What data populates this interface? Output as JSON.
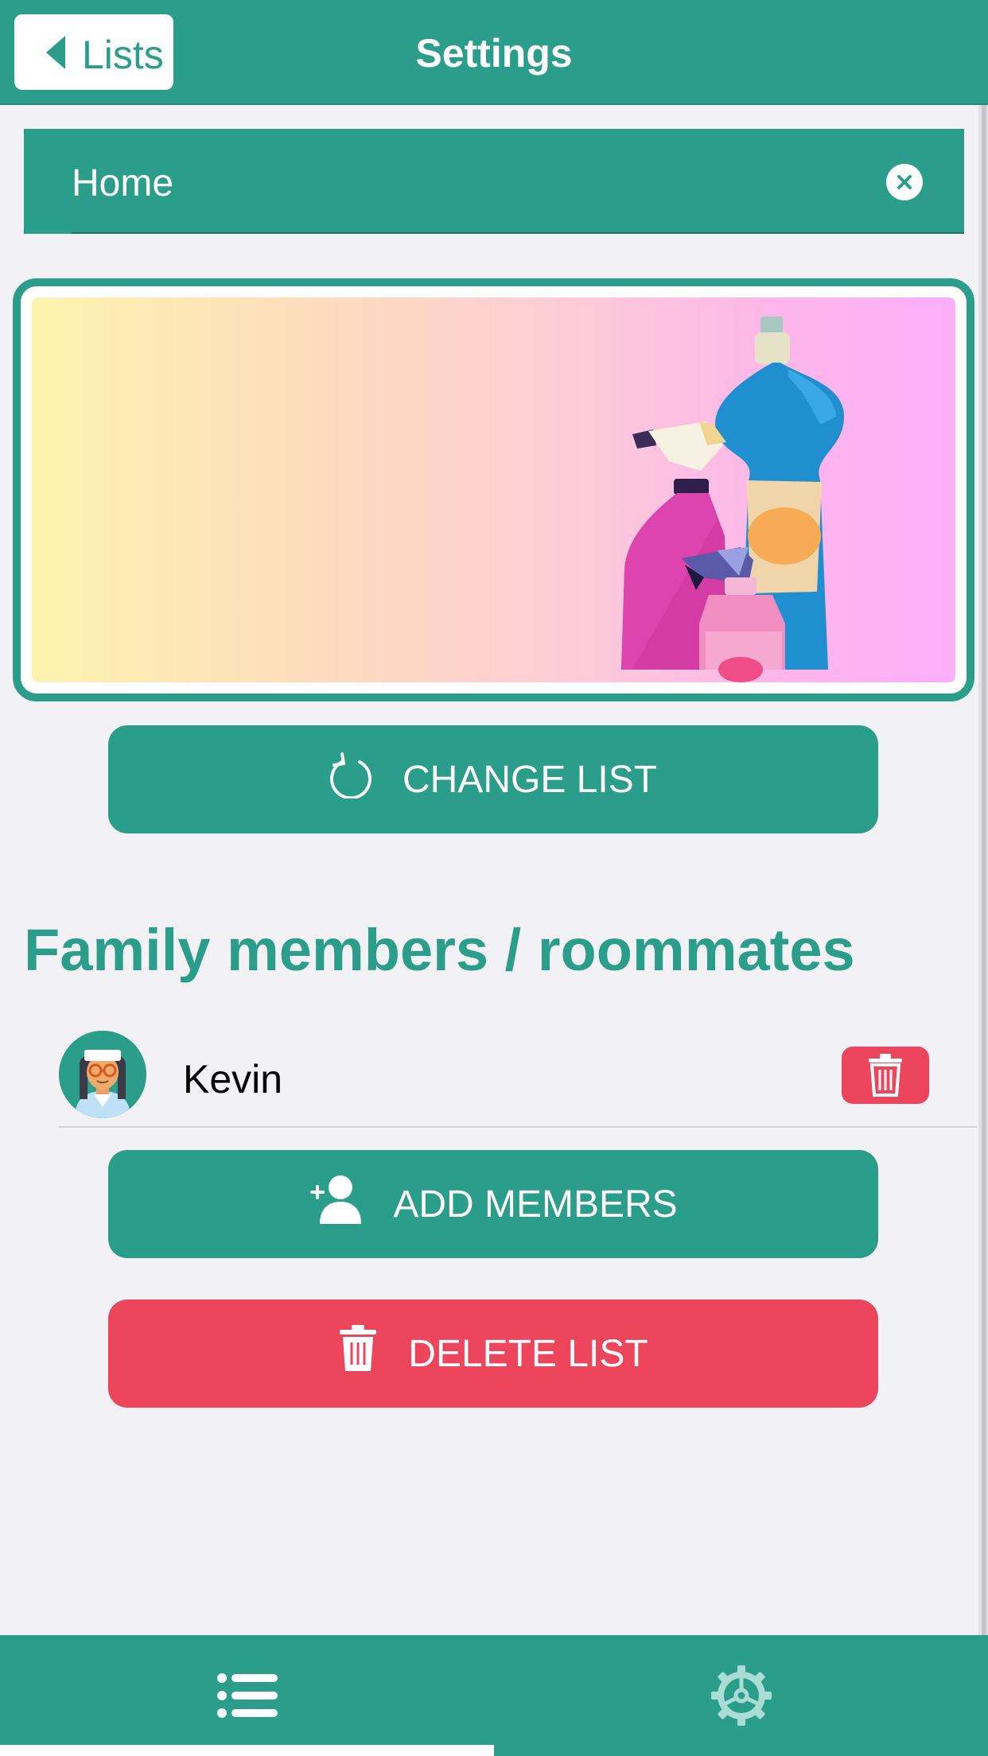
{
  "header": {
    "back_label": "Lists",
    "title": "Settings"
  },
  "list_name": {
    "value": "Home"
  },
  "change_list_button": {
    "label": "CHANGE LIST"
  },
  "members_section": {
    "title": "Family members / roommates",
    "members": [
      {
        "name": "Kevin"
      }
    ]
  },
  "add_members_button": {
    "label": "ADD MEMBERS"
  },
  "delete_list_button": {
    "label": "DELETE LIST"
  },
  "tabbar": {
    "tabs": [
      {
        "icon": "list-icon",
        "selected": true
      },
      {
        "icon": "gear-icon",
        "selected": false
      }
    ]
  },
  "colors": {
    "primary": "#2a9d8b",
    "danger": "#ec455c",
    "background": "#f2f2f6"
  },
  "icons": {
    "back": "chevron-left-icon",
    "clear": "clear-x-icon",
    "refresh": "refresh-icon",
    "add_person": "add-person-icon",
    "trash": "trash-icon"
  }
}
